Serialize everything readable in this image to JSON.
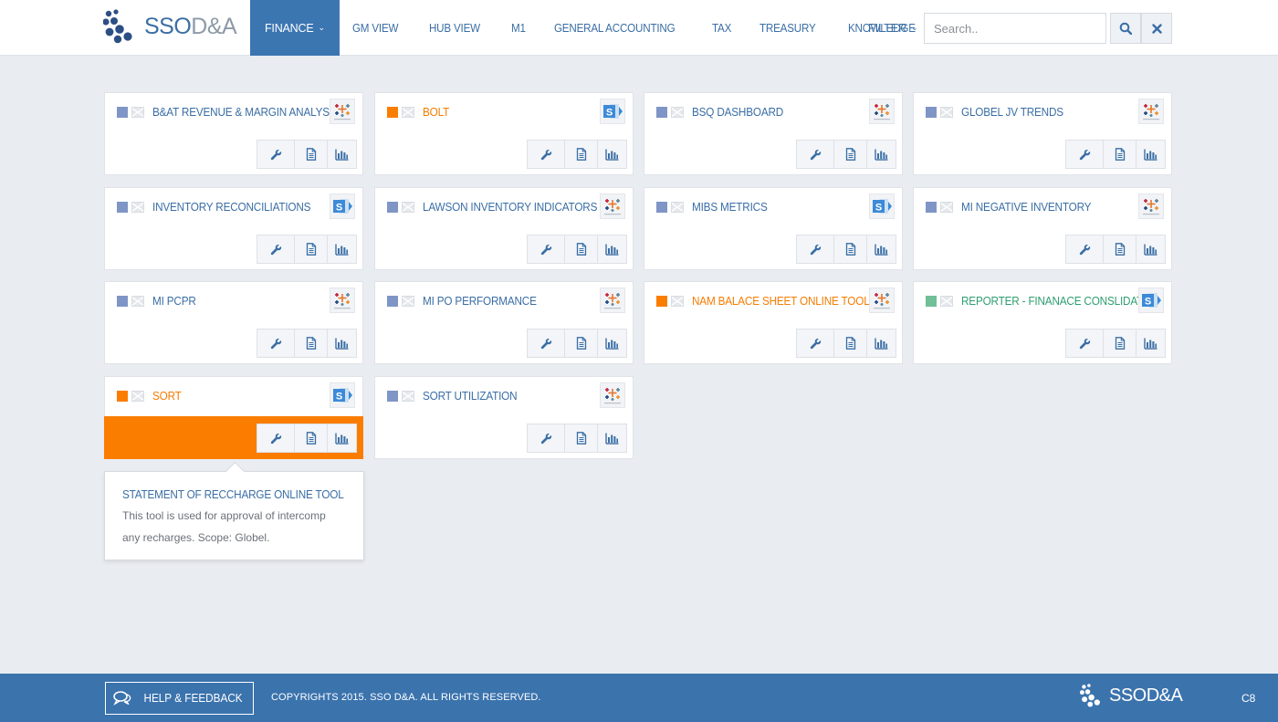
{
  "header": {
    "logo_primary": "SSO",
    "logo_secondary": "D&A",
    "nav": [
      {
        "label": "FINANCE",
        "active": true,
        "dropdown": true
      },
      {
        "label": "GM VIEW"
      },
      {
        "label": "HUB VIEW"
      },
      {
        "label": "M1"
      },
      {
        "label": "GENERAL ACCOUNTING"
      },
      {
        "label": "TAX"
      },
      {
        "label": "TREASURY"
      },
      {
        "label": "KNOWLEDGE"
      }
    ],
    "filter_label": "FILTER",
    "search_placeholder": "Search..",
    "search_value": ""
  },
  "tiles": [
    {
      "title": "B&AT REVENUE & MARGIN ANALYSIS",
      "square_color": "#7f95c6",
      "title_color": "blue",
      "badge": "tableau-icon"
    },
    {
      "title": "BOLT",
      "square_color": "#fb7d00",
      "title_color": "orange",
      "badge": "sharepoint-icon"
    },
    {
      "title": "BSQ DASHBOARD",
      "square_color": "#7f95c6",
      "title_color": "blue",
      "badge": "tableau-icon"
    },
    {
      "title": "GLOBEL JV TRENDS",
      "square_color": "#7f95c6",
      "title_color": "blue",
      "badge": "tableau-icon"
    },
    {
      "title": "INVENTORY RECONCILIATIONS",
      "square_color": "#7f95c6",
      "title_color": "blue",
      "badge": "sharepoint-icon"
    },
    {
      "title": "LAWSON INVENTORY INDICATORS",
      "square_color": "#7f95c6",
      "title_color": "blue",
      "badge": "tableau-icon"
    },
    {
      "title": "MIBS METRICS",
      "square_color": "#7f95c6",
      "title_color": "blue",
      "badge": "sharepoint-icon"
    },
    {
      "title": "MI NEGATIVE INVENTORY",
      "square_color": "#7f95c6",
      "title_color": "blue",
      "badge": "tableau-icon"
    },
    {
      "title": "MI PCPR",
      "square_color": "#7f95c6",
      "title_color": "blue",
      "badge": "tableau-icon"
    },
    {
      "title": "MI PO PERFORMANCE",
      "square_color": "#7f95c6",
      "title_color": "blue",
      "badge": "tableau-icon"
    },
    {
      "title": "NAM BALACE SHEET ONLINE TOOL",
      "square_color": "#fb7d00",
      "title_color": "orange",
      "badge": "tableau-icon"
    },
    {
      "title": "REPORTER - FINANACE CONSLIDATED",
      "square_color": "#6fbf97",
      "title_color": "green",
      "badge": "sharepoint-icon"
    },
    {
      "title": "SORT",
      "square_color": "#fb7d00",
      "title_color": "orange",
      "badge": "sharepoint-icon",
      "highlighted": true
    },
    {
      "title": "SORT UTILIZATION",
      "square_color": "#7f95c6",
      "title_color": "blue",
      "badge": "tableau-icon"
    }
  ],
  "tile_actions": [
    "wrench-icon",
    "document-icon",
    "bar-chart-icon"
  ],
  "popup": {
    "title": "STATEMENT OF RECCHARGE ONLINE TOOL",
    "description": "This tool is used for approval of intercomp any recharges. Scope: Globel."
  },
  "footer": {
    "help_label": "HELP & FEEDBACK",
    "copyright": "COPYRIGHTS 2015. SSO D&A. ALL RIGHTS RESERVED.",
    "logo": "SSOD&A",
    "version": "C8"
  },
  "colors": {
    "accent": "#3c76b1",
    "highlight": "#fb7d00",
    "footer": "#3b73ad",
    "background": "#e9ecf1"
  }
}
